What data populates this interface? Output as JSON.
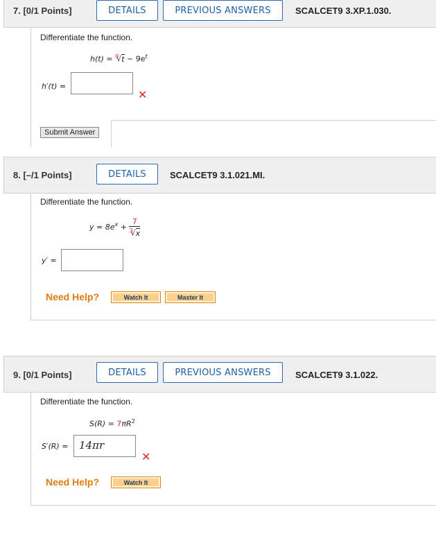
{
  "q7": {
    "number": "7.",
    "points": "[0/1 Points]",
    "details": "DETAILS",
    "previous": "PREVIOUS ANSWERS",
    "code": "SCALCET9 3.XP.1.030.",
    "prompt": "Differentiate the function.",
    "eq_left": "h(t) = ",
    "root_index": "9",
    "radicand": "t",
    "eq_mid": " − 9e",
    "eq_exp": "t",
    "answer_label": "h′(t) =",
    "answer_value": "",
    "submit": "Submit Answer"
  },
  "q8": {
    "number": "8.",
    "points": "[–/1 Points]",
    "details": "DETAILS",
    "code": "SCALCET9 3.1.021.MI.",
    "prompt": "Differentiate the function.",
    "eq_left": "y = 8e",
    "eq_exp": "x",
    "plus": " + ",
    "frac_num": "7",
    "root_index": "3",
    "radicand": "x",
    "answer_label": "y′ =",
    "answer_value": "",
    "need_help": "Need Help?",
    "watch": "Watch It",
    "master": "Master It"
  },
  "q9": {
    "number": "9.",
    "points": "[0/1 Points]",
    "details": "DETAILS",
    "previous": "PREVIOUS ANSWERS",
    "code": "SCALCET9 3.1.022.",
    "prompt": "Differentiate the function.",
    "eq_left": "S(R) = ",
    "eq_red": "7",
    "eq_rest": "πR",
    "eq_exp": "2",
    "answer_label": "S′(R) =",
    "answer_value": "14πr",
    "need_help": "Need Help?",
    "watch": "Watch It"
  },
  "colors": {
    "link_blue": "#1f5fa5",
    "error_red": "#e0252b",
    "help_orange": "#e07b12",
    "button_orange": "#fbd08b"
  },
  "icons": {
    "incorrect": "x-mark-icon"
  }
}
